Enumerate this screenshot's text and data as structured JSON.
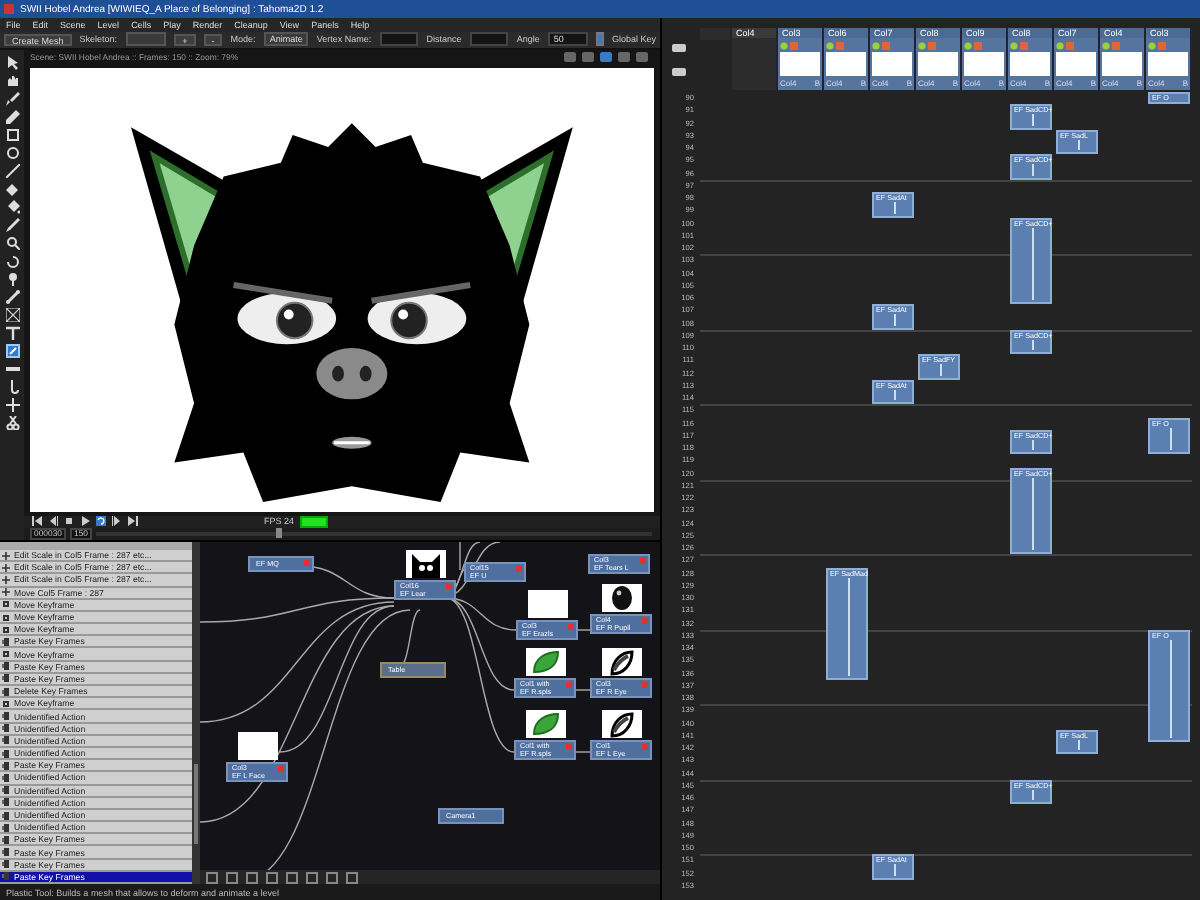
{
  "window": {
    "title": "SWII Hobel Andrea [WIWIEQ_A Place of Belonging] : Tahoma2D 1.2"
  },
  "menu": [
    "File",
    "Edit",
    "Scene",
    "Level",
    "Cells",
    "Play",
    "Render",
    "Cleanup",
    "View",
    "Panels",
    "Help"
  ],
  "tool_options": {
    "create_mesh": "Create Mesh",
    "skeleton_label": "Skeleton:",
    "plus": "+",
    "minus": "-",
    "mode_label": "Mode:",
    "mode_value": "Animate",
    "vertex_label": "Vertex Name:",
    "distance_label": "Distance",
    "angle_label": "Angle",
    "angle_value": "50",
    "global_key": {
      "label": "Global Key",
      "checked": true
    }
  },
  "viewer": {
    "header": "Scene: SWII Hobel Andrea  ::  Frames: 150  ::  Zoom: 79%",
    "fps_label": "FPS 24",
    "frame_field": "000030",
    "frame_count": "150",
    "frame_slider": {
      "level": 0.33
    }
  },
  "history": [
    {
      "label": "Edit Scale in Col5 Frame : 287 etc...",
      "kind": "scale",
      "selected": false
    },
    {
      "label": "Edit Scale in Col5 Frame : 287 etc...",
      "kind": "scale",
      "selected": false
    },
    {
      "label": "Edit Scale in Col5 Frame : 287 etc...",
      "kind": "scale",
      "selected": false
    },
    {
      "label": "Move Col5 Frame : 287",
      "kind": "scale",
      "selected": false
    },
    {
      "label": "Move Keyframe",
      "kind": "key",
      "selected": false
    },
    {
      "label": "Move Keyframe",
      "kind": "key",
      "selected": false
    },
    {
      "label": "Move Keyframe",
      "kind": "key",
      "selected": false
    },
    {
      "label": "Paste Key Frames",
      "kind": "paste",
      "selected": false
    },
    {
      "label": "Move Keyframe",
      "kind": "key",
      "selected": false
    },
    {
      "label": "Paste Key Frames",
      "kind": "paste",
      "selected": false
    },
    {
      "label": "Paste Key Frames",
      "kind": "paste",
      "selected": false
    },
    {
      "label": "Delete Key Frames",
      "kind": "paste",
      "selected": false
    },
    {
      "label": "Move Keyframe",
      "kind": "key",
      "selected": false
    },
    {
      "label": "Unidentified Action",
      "kind": "paste",
      "selected": false
    },
    {
      "label": "Unidentified Action",
      "kind": "paste",
      "selected": false
    },
    {
      "label": "Unidentified Action",
      "kind": "paste",
      "selected": false
    },
    {
      "label": "Unidentified Action",
      "kind": "paste",
      "selected": false
    },
    {
      "label": "Paste Key Frames",
      "kind": "paste",
      "selected": false
    },
    {
      "label": "Unidentified Action",
      "kind": "paste",
      "selected": false
    },
    {
      "label": "Unidentified Action",
      "kind": "paste",
      "selected": false
    },
    {
      "label": "Unidentified Action",
      "kind": "paste",
      "selected": false
    },
    {
      "label": "Unidentified Action",
      "kind": "paste",
      "selected": false
    },
    {
      "label": "Unidentified Action",
      "kind": "paste",
      "selected": false
    },
    {
      "label": "Paste Key Frames",
      "kind": "paste",
      "selected": false
    },
    {
      "label": "Paste Key Frames",
      "kind": "paste",
      "selected": false
    },
    {
      "label": "Paste Key Frames",
      "kind": "paste",
      "selected": false
    },
    {
      "label": "Paste Key Frames",
      "kind": "paste",
      "selected": true
    }
  ],
  "node_editor": {
    "nodes": [
      {
        "kind": "column",
        "title": "EF MQ"
      },
      {
        "kind": "column",
        "title": "Col16",
        "subtitle": "EF Lear",
        "thumbnail": {
          "kind": "head"
        }
      },
      {
        "kind": "column",
        "title": "Col15",
        "subtitle": "EF U"
      },
      {
        "kind": "column",
        "title": "Col3",
        "subtitle": "EF Tears L"
      },
      {
        "kind": "column",
        "title": "Col3",
        "subtitle": "EF Erazls",
        "thumbnail": {
          "kind": "blank"
        }
      },
      {
        "kind": "column",
        "title": "Col4",
        "subtitle": "EF R Pupil",
        "thumbnail": {
          "kind": "pupil"
        }
      },
      {
        "kind": "table",
        "title": "Table"
      },
      {
        "kind": "column",
        "title": "Col1 with",
        "subtitle": "EF R.spls",
        "thumbnail": {
          "kind": "leaf"
        }
      },
      {
        "kind": "column",
        "title": "Col3",
        "subtitle": "EF R Eye",
        "thumbnail": {
          "kind": "eye"
        }
      },
      {
        "kind": "column",
        "title": "Col3",
        "subtitle": "EF L Face",
        "thumbnail": {
          "kind": "blank"
        }
      },
      {
        "kind": "column",
        "title": "Col1 with",
        "subtitle": "EF R.spls",
        "thumbnail": {
          "kind": "leaf"
        }
      },
      {
        "kind": "column",
        "title": "Col1",
        "subtitle": "EF L Eye",
        "thumbnail": {
          "kind": "eye"
        }
      },
      {
        "kind": "camera",
        "title": "Camera1"
      }
    ]
  },
  "xsheet": {
    "columns": [
      {
        "name": "Col4",
        "kind": "empty"
      },
      {
        "name": "Col3",
        "kind": "level",
        "level": "Col4",
        "tag": "B"
      },
      {
        "name": "Col6",
        "kind": "level",
        "level": "Col4",
        "tag": "B",
        "blocks": [
          {
            "label": "EF SadMad"
          }
        ]
      },
      {
        "name": "Col7",
        "kind": "level",
        "level": "Col4",
        "tag": "B",
        "blocks": [
          {
            "label": "EF SadAt"
          },
          {
            "label": "EF SadAt"
          },
          {
            "label": "EF SadAt"
          },
          {
            "label": "EF SadAt"
          }
        ]
      },
      {
        "name": "Col8",
        "kind": "level",
        "level": "Col4",
        "tag": "B",
        "blocks": [
          {
            "label": "EF SadFY"
          }
        ]
      },
      {
        "name": "Col9",
        "kind": "level",
        "level": "Col4",
        "tag": "B"
      },
      {
        "name": "Col8",
        "kind": "level",
        "level": "Col4",
        "tag": "B",
        "blocks": [
          {
            "label": "EF SadCD+"
          },
          {
            "label": "EF SadCD+"
          },
          {
            "label": "EF SadCD+"
          },
          {
            "label": "EF SadCD+"
          },
          {
            "label": "EF SadCD+"
          },
          {
            "label": "EF SadCD+"
          },
          {
            "label": "EF SadCD+"
          }
        ]
      },
      {
        "name": "Col7",
        "kind": "level",
        "level": "Col4",
        "tag": "B",
        "blocks": [
          {
            "label": "EF SadL"
          },
          {
            "label": "EF SadL"
          }
        ]
      },
      {
        "name": "Col4",
        "kind": "level",
        "level": "Col4",
        "tag": "B"
      },
      {
        "name": "Col3",
        "kind": "level",
        "level": "Col4",
        "tag": "B",
        "blocks": [
          {
            "label": "EF O"
          },
          {
            "label": "EF O"
          },
          {
            "label": "EF O"
          }
        ]
      }
    ],
    "frames": [
      "90",
      "91",
      "92",
      "93",
      "94",
      "95",
      "96",
      "97",
      "98",
      "99",
      "100",
      "101",
      "102",
      "103",
      "104",
      "105",
      "106",
      "107",
      "108",
      "109",
      "110",
      "111",
      "112",
      "113",
      "114",
      "115",
      "116",
      "117",
      "118",
      "119",
      "120",
      "121",
      "122",
      "123",
      "124",
      "125",
      "126",
      "127",
      "128",
      "129",
      "130",
      "131",
      "132",
      "133",
      "134",
      "135",
      "136",
      "137",
      "138",
      "139",
      "140",
      "141",
      "142",
      "143",
      "144",
      "145",
      "146",
      "147",
      "148",
      "149",
      "150",
      "151",
      "152",
      "153"
    ]
  },
  "status_bar": "Plastic Tool: Builds a mesh that allows to deform and animate a level"
}
